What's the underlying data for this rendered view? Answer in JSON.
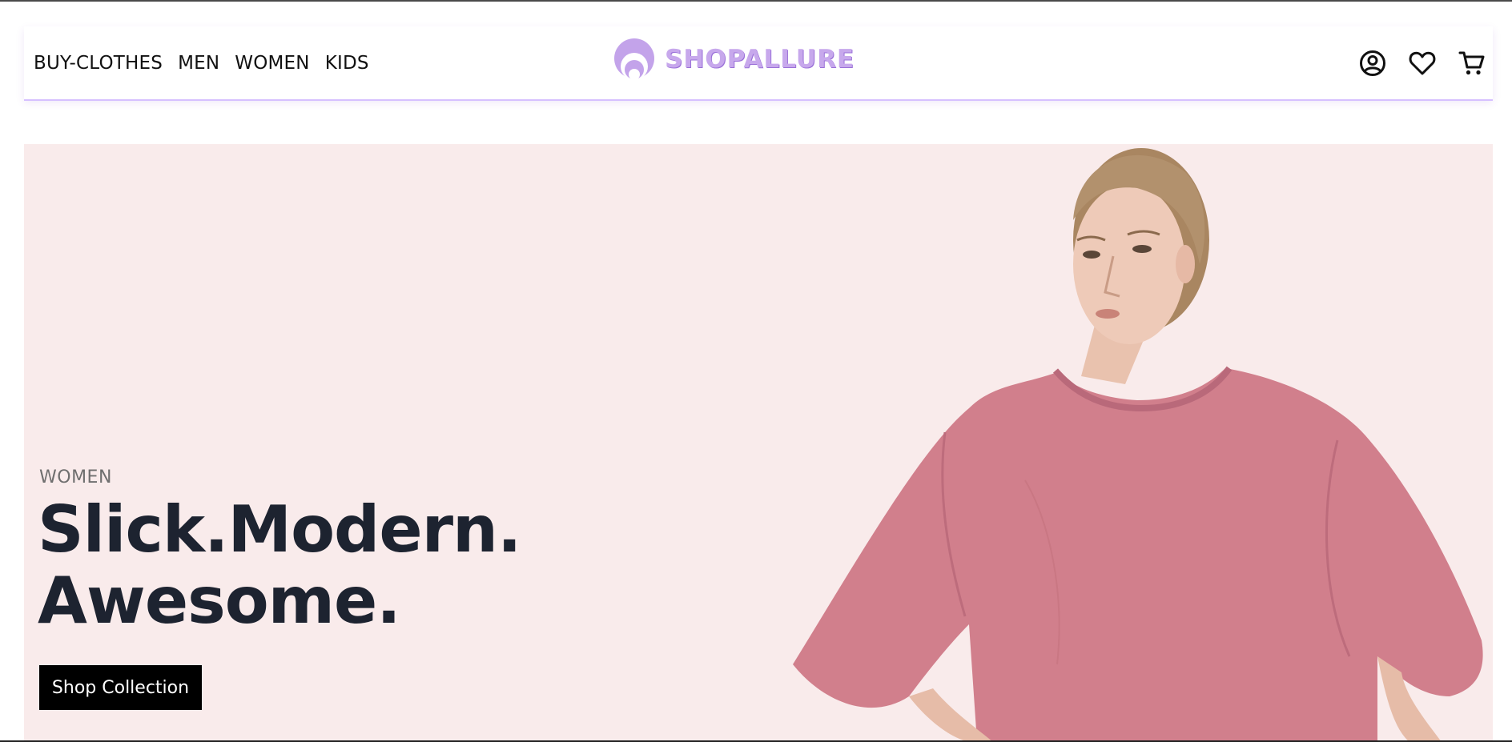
{
  "nav": {
    "links": [
      "BUY-CLOTHES",
      "MEN",
      "WOMEN",
      "KIDS"
    ]
  },
  "brand": {
    "name": "SHOPALLURE",
    "logo_icon": "crescent-logo-icon",
    "color": "#c7a8ec"
  },
  "nav_icons": [
    "account-icon",
    "heart-icon",
    "cart-icon"
  ],
  "hero": {
    "eyebrow": "WOMEN",
    "title_line1": "Slick.Modern.",
    "title_line2": "Awesome.",
    "button_label": "Shop Collection",
    "background_color": "#f9ebeb",
    "shirt_color": "#d17f8c"
  }
}
